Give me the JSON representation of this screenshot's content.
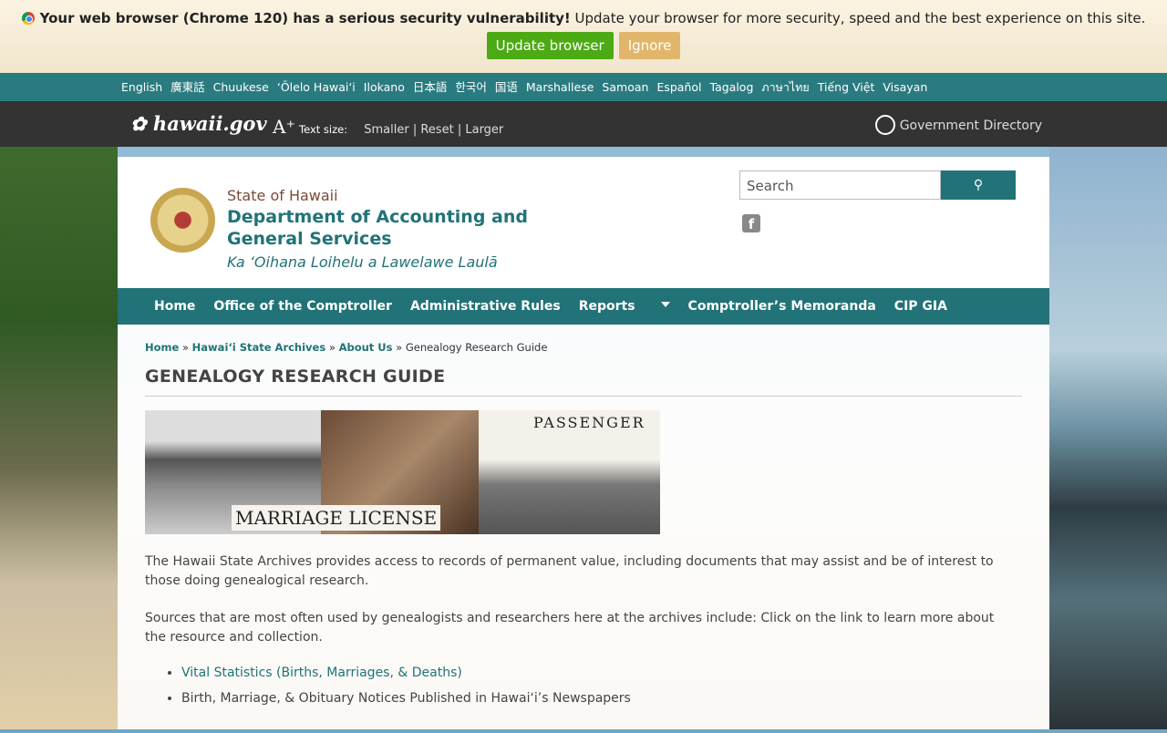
{
  "warning": {
    "bold": "Your web browser (Chrome 120) has a serious security vulnerability!",
    "text": " Update your browser for more security, speed and the best experience on this site.",
    "update": "Update browser",
    "ignore": "Ignore"
  },
  "languages": [
    "English",
    "廣東話",
    "Chuukese",
    "ʻŌlelo Hawaiʻi",
    "Ilokano",
    "日本語",
    "한국어",
    "国语",
    "Marshallese",
    "Samoan",
    "Español",
    "Tagalog",
    "ภาษาไทย",
    "Tiếng Việt",
    "Visayan"
  ],
  "topbar": {
    "logo": "hawaii.gov",
    "text_size_label": "Text size:",
    "smaller": "Smaller",
    "reset": "Reset",
    "larger": "Larger",
    "sep": "|",
    "gov_dir": "Government Directory"
  },
  "header": {
    "state": "State of Hawaii",
    "dept": "Department of Accounting and General Services",
    "hawaiian": "Ka ʻOihana Loihelu a Lawelawe Laulā",
    "search_placeholder": "Search",
    "facebook": "f"
  },
  "nav": [
    "Home",
    "Office of the Comptroller",
    "Administrative Rules",
    "Reports",
    "Comptroller’s Memoranda",
    "CIP GIA"
  ],
  "breadcrumb": {
    "home": "Home",
    "archives": "Hawaiʻi State Archives",
    "about": "About Us",
    "current": "Genealogy Research Guide",
    "sep": "»"
  },
  "page": {
    "title": "GENEALOGY RESEARCH GUIDE",
    "image_text_1": "MARRIAGE LICENSE",
    "image_text_2": "PASSENGER",
    "para1": "The Hawaii State Archives provides access to records of permanent value, including documents that may assist and be of interest to those doing genealogical research.",
    "para2": "Sources that are most often used by genealogists and researchers here at the archives include: Click on the link to learn more about the resource and collection.",
    "items": [
      "Vital Statistics (Births, Marriages, & Deaths)",
      "Birth, Marriage, & Obituary Notices Published in Hawaiʻi’s Newspapers"
    ]
  }
}
